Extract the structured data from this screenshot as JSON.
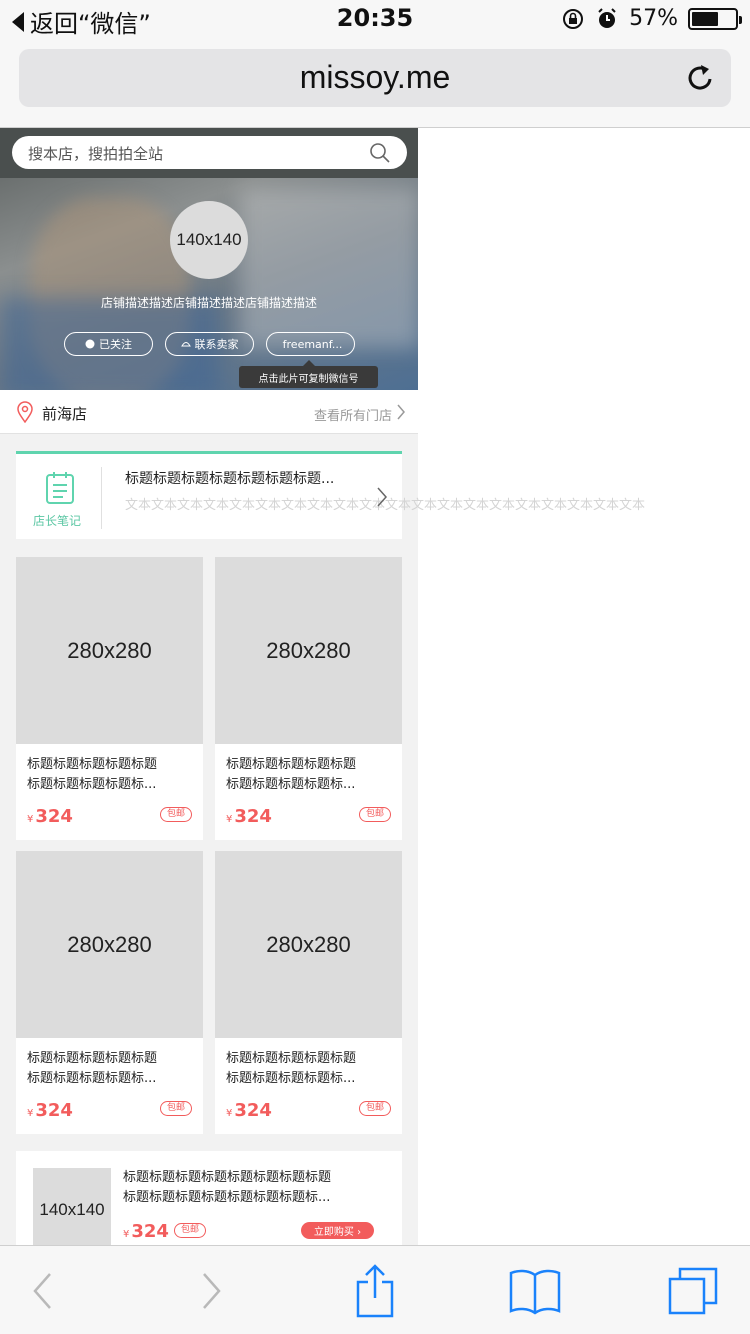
{
  "status_bar": {
    "back_label": "返回“微信”",
    "time": "20:35",
    "battery": "57%",
    "battery_level": 0.57
  },
  "browser": {
    "url": "missoy.me"
  },
  "shop": {
    "search_placeholder": "搜本店，搜拍拍全站",
    "avatar_label": "140x140",
    "description": "店铺描述描述店铺描述描述店铺描述描述",
    "buttons": [
      {
        "label": "已关注",
        "icon": "follow-icon"
      },
      {
        "label": "联系卖家",
        "icon": "contact-icon"
      },
      {
        "label": "freemanf...",
        "icon": "wechat-icon"
      }
    ],
    "tooltip": "点击此片可复制微信号"
  },
  "store": {
    "name": "前海店",
    "all_stores": "查看所有门店"
  },
  "note": {
    "label": "店长笔记",
    "title": "标题标题标题标题标题标题标题...",
    "text": "文本文本文本文本文本文本文本文本文本文本文本文本文本文本文本文本文本文本文本文本"
  },
  "products": [
    {
      "image_label": "280x280",
      "title_line1": "标题标题标题标题标题",
      "title_line2": "标题标题标题标题标...",
      "currency": "¥",
      "price": "324",
      "tag": "包邮"
    },
    {
      "image_label": "280x280",
      "title_line1": "标题标题标题标题标题",
      "title_line2": "标题标题标题标题标...",
      "currency": "¥",
      "price": "324",
      "tag": "包邮"
    },
    {
      "image_label": "280x280",
      "title_line1": "标题标题标题标题标题",
      "title_line2": "标题标题标题标题标...",
      "currency": "¥",
      "price": "324",
      "tag": "包邮"
    },
    {
      "image_label": "280x280",
      "title_line1": "标题标题标题标题标题",
      "title_line2": "标题标题标题标题标...",
      "currency": "¥",
      "price": "324",
      "tag": "包邮"
    }
  ],
  "list_item": {
    "image_label": "140x140",
    "title_line1": "标题标题标题标题标题标题标题标题",
    "title_line2": "标题标题标题标题标题标题标题标...",
    "currency": "¥",
    "price": "324",
    "tag": "包邮",
    "buy_label": "立即购买 ›"
  },
  "colors": {
    "accent_red": "#f25c5c",
    "accent_green": "#5fd4ae",
    "ios_blue": "#1a82fb"
  }
}
